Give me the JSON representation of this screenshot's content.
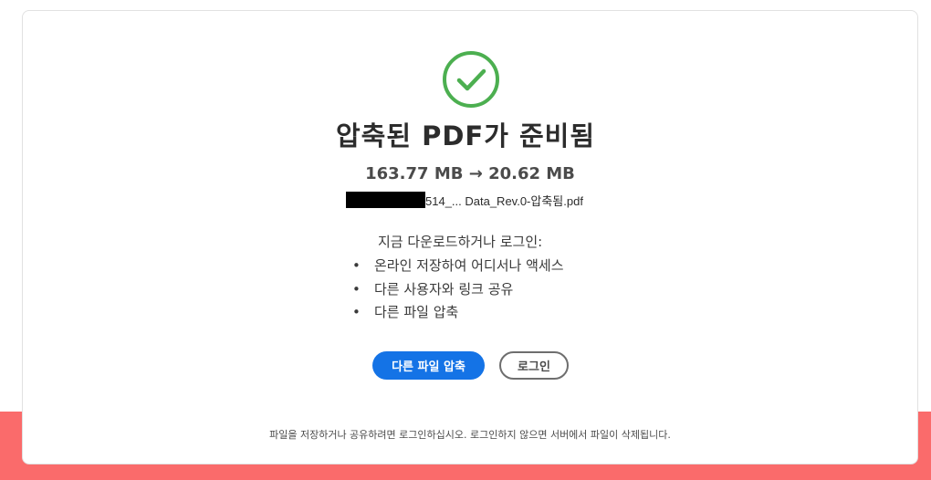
{
  "result": {
    "title": "압축된 PDF가 준비됨",
    "size_change": "163.77 MB → 20.62 MB",
    "file_name": "514_... Data_Rev.0-압축됨.pdf"
  },
  "login_prompt": {
    "intro": "지금 다운로드하거나 로그인:",
    "bullet_symbol": "•",
    "benefits": [
      "온라인 저장하여 어디서나 액세스",
      "다른 사용자와 링크 공유",
      "다른 파일 압축"
    ]
  },
  "actions": {
    "compress_another_label": "다른 파일 압축",
    "login_label": "로그인"
  },
  "footer": {
    "note": "파일을 저장하거나 공유하려면 로그인하십시오. 로그인하지 않으면 서버에서 파일이 삭제됩니다."
  },
  "icons": {
    "success": "check-circle-icon"
  },
  "colors": {
    "success_green": "#4caf50",
    "primary_blue": "#1473e6",
    "footer_band": "#fa6b6b"
  }
}
